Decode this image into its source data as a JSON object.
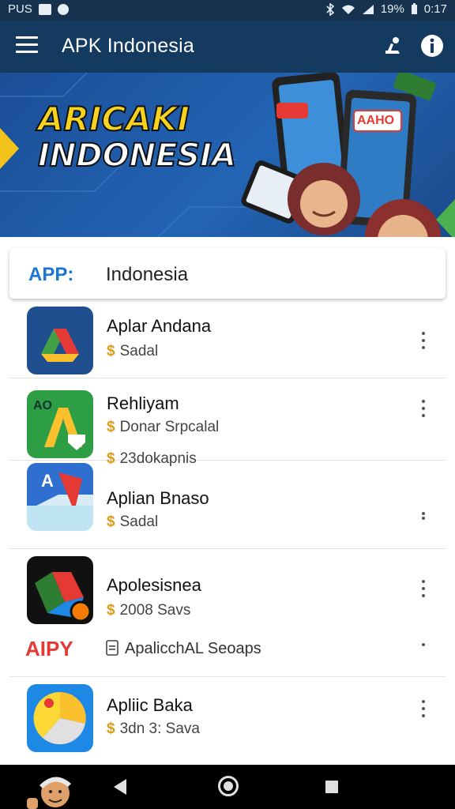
{
  "status_bar": {
    "carrier": "PUS",
    "time": "0:17",
    "battery": "19%",
    "icons": [
      "message-icon",
      "notification-icon",
      "bluetooth-icon",
      "wifi-icon",
      "signal-icon",
      "battery-icon"
    ]
  },
  "app_bar": {
    "title": "APK Indonesia",
    "icons": [
      "menu-icon",
      "user-icon",
      "info-icon"
    ]
  },
  "banner": {
    "line1": "ARICAKI",
    "line2": "INDONESIA",
    "phone_label": "AAHO"
  },
  "search": {
    "prefix": "APP:",
    "value": "Indonesia"
  },
  "apps": [
    {
      "name": "Aplar Andana",
      "lines": [
        "Sadal"
      ],
      "icon": "drive-style-app-icon"
    },
    {
      "name": "Rehliyam",
      "lines": [
        "Donar Srpcalal",
        "23dokapnis"
      ],
      "icon": "ao-app-icon"
    },
    {
      "name": "Aplian Bnaso",
      "lines": [
        "Sadal"
      ],
      "icon": "a-letter-app-icon",
      "icon_text": "A"
    },
    {
      "name": "Apolesisnea",
      "lines": [
        "2008 Savs"
      ],
      "icon": "maps-style-app-icon"
    },
    {
      "name": "Apliic Baka",
      "lines": [
        "3dn 3: Sava"
      ],
      "icon": "chrome-style-app-icon"
    }
  ],
  "promo": {
    "logo": "AIPY",
    "text": "ApalicchAL Seoaps"
  },
  "nav_bar": {
    "icons": [
      "back-icon",
      "home-icon",
      "recents-icon"
    ]
  },
  "colors": {
    "status_bar": "#16324f",
    "app_bar": "#153a60",
    "banner_bg": "#2364b4",
    "banner_title_yellow": "#f7d21e",
    "search_prefix": "#1976d2",
    "promo_logo": "#e53935",
    "coin": "#e09a1a"
  }
}
